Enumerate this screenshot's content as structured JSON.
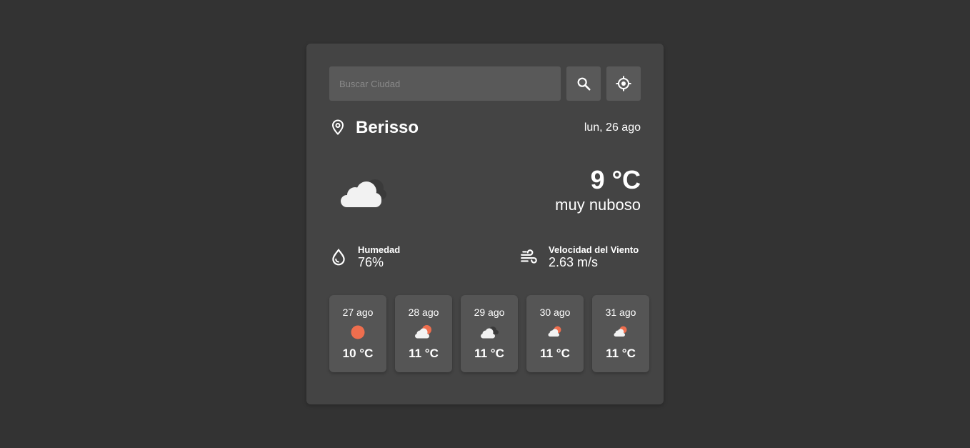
{
  "search": {
    "placeholder": "Buscar Ciudad",
    "value": "",
    "search_icon": "search-icon",
    "location_icon": "crosshair-location-icon"
  },
  "location": {
    "icon": "map-pin-icon",
    "city": "Berisso",
    "date": "lun, 26 ago"
  },
  "current": {
    "icon": "broken-clouds-icon",
    "temperature": "9 °C",
    "description": "muy nuboso"
  },
  "stats": {
    "humidity": {
      "icon": "droplet-icon",
      "label": "Humedad",
      "value": "76%"
    },
    "wind": {
      "icon": "wind-icon",
      "label": "Velocidad del Viento",
      "value": "2.63 m/s"
    }
  },
  "forecast": [
    {
      "date": "27 ago",
      "icon": "clear-sun-icon",
      "temp": "10 °C"
    },
    {
      "date": "28 ago",
      "icon": "sun-behind-cloud-icon",
      "temp": "11 °C"
    },
    {
      "date": "29 ago",
      "icon": "broken-clouds-icon",
      "temp": "11 °C"
    },
    {
      "date": "30 ago",
      "icon": "sun-behind-cloud-icon",
      "temp": "11 °C"
    },
    {
      "date": "31 ago",
      "icon": "sun-behind-cloud-icon",
      "temp": "11 °C"
    }
  ],
  "colors": {
    "background": "#333333",
    "card": "#444444",
    "input": "#595959",
    "forecast_card": "#555555",
    "sun": "#ee6e4e",
    "cloud": "#f2f2f2",
    "dark_cloud": "#3a3a3a"
  }
}
